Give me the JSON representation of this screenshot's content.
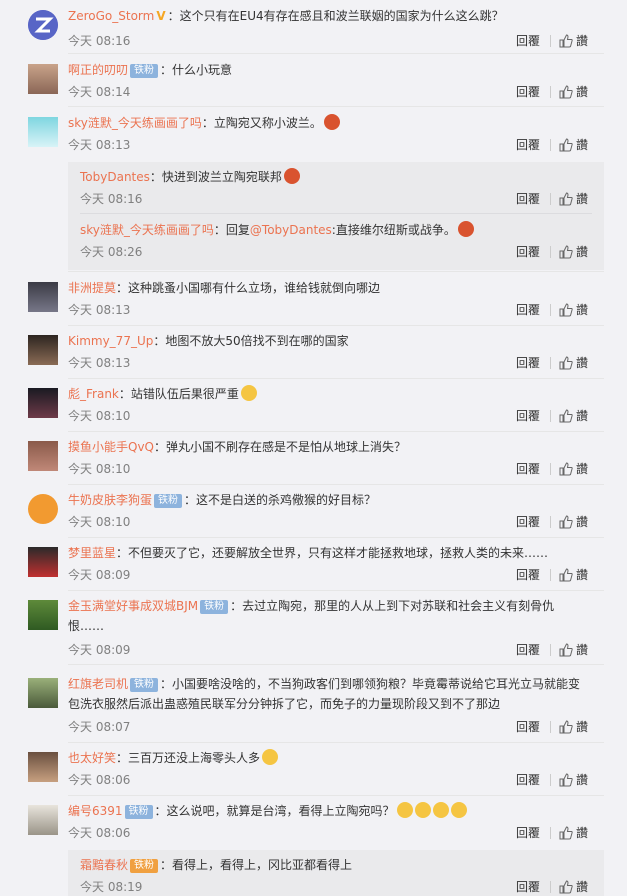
{
  "ui": {
    "reply": "回覆",
    "like": "讚"
  },
  "comments": [
    {
      "user": "ZeroGo_Storm",
      "text": "：这个只有在EU4有存在感且和波兰联姻的国家为什么这么跳？",
      "time": "今天 08:16"
    },
    {
      "user": "啊正的叨叨",
      "badge": "铁粉",
      "text": "：什么小玩意",
      "time": "今天 08:14"
    },
    {
      "user": "sky涟默_今天练画画了吗",
      "text": "：立陶宛又称小波兰。",
      "time": "今天 08:13"
    },
    {
      "user": "非洲提莫",
      "text": "：这种跳蚤小国哪有什么立场，谁给钱就倒向哪边",
      "time": "今天 08:13"
    },
    {
      "user": "Kimmy_77_Up",
      "text": "：地图不放大50倍找不到在哪的国家",
      "time": "今天 08:13"
    },
    {
      "user": "彪_Frank",
      "text": "：站错队伍后果很严重",
      "time": "今天 08:10"
    },
    {
      "user": "摸鱼小能手QvQ",
      "text": "：弹丸小国不刷存在感是不是怕从地球上消失？",
      "time": "今天 08:10"
    },
    {
      "user": "牛奶皮肤李狗蛋",
      "badge": "铁粉",
      "text": "：这不是白送的杀鸡儆猴的好目标？",
      "time": "今天 08:10"
    },
    {
      "user": "梦里蓝星",
      "text": "：不但要灭了它，还要解放全世界，只有这样才能拯救地球，拯救人类的未来……",
      "time": "今天 08:09"
    },
    {
      "user": "金玉满堂好事成双城BJM",
      "badge": "铁粉",
      "text": "：去过立陶宛，那里的人从上到下对苏联和社会主义有刻骨仇",
      "text2": "恨……",
      "time": "今天 08:09"
    },
    {
      "user": "红旗老司机",
      "badge": "铁粉",
      "text": "：小国要啥没啥的，不当狗政客们到哪领狗粮？毕竟霉蒂说给它耳光立马就能变",
      "text2": "包洗衣服然后派出蛊惑殖民联军分分钟拆了它，而免子的力量现阶段又到不了那边",
      "time": "今天 08:07"
    },
    {
      "user": "也太好笑",
      "text": "：三百万还没上海零头人多",
      "time": "今天 08:06"
    },
    {
      "user": "编号6391",
      "badge": "铁粉",
      "text": "：这么说吧，就算是台湾，看得上立陶宛吗？",
      "time": "今天 08:06"
    }
  ],
  "replies": [
    {
      "user": "TobyDantes",
      "text": "：快进到波兰立陶宛联邦",
      "time": "今天 08:16"
    },
    {
      "user": "sky涟默_今天练画画了吗",
      "text": "：回复",
      "mention": "@TobyDantes",
      "text_after": ":直接维尔纽斯或战争。",
      "time": "今天 08:26"
    },
    {
      "user": "霜黯春秋",
      "badge": "铁粉",
      "text": "：看得上，看得上，冈比亚都看得上",
      "time": "今天 08:19"
    }
  ]
}
